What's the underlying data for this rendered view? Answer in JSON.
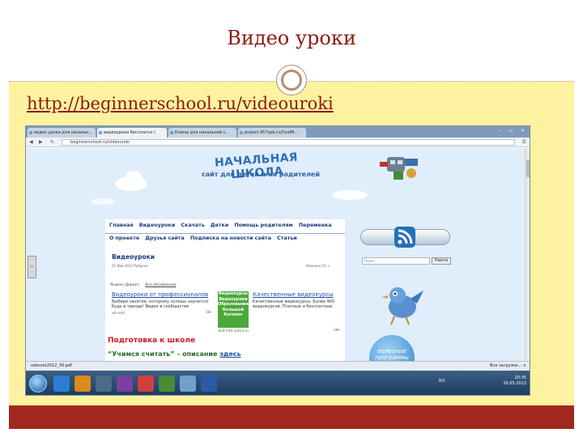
{
  "slide": {
    "title": "Видео уроки",
    "link": "http://beginnerschool.ru/videouroki"
  },
  "browser": {
    "tabs": [
      {
        "label": "видео уроки для начальн..."
      },
      {
        "label": "видеоуроки бесплатно ("
      },
      {
        "label": "Клипы для начальной с..."
      },
      {
        "label": "project.457spb.ru/DvaMi..."
      }
    ],
    "url": "beginnerschool.ru/videouroki"
  },
  "site": {
    "header_title": "НАЧАЛЬНАЯ ШКОЛА",
    "header_subtitle": "сайт для детей и их родителей",
    "menu_row1": [
      "Главная",
      "Видеоуроки",
      "Скачать",
      "Детки",
      "Помощь родителям",
      "Переменка"
    ],
    "menu_row2": [
      "О проекте",
      "Друзья сайта",
      "Подписка на новости сайта",
      "Статьи"
    ],
    "section_title": "Видеоуроки",
    "section_date": "25 Фев 2012 Рубрика",
    "section_meta": "Изменен (0) »",
    "ads_header": [
      "Яндекс.Директ",
      "Все объявления"
    ],
    "ad1": {
      "title": "Видеоуроки от профессионалов",
      "text": "Выбери занятие, которому хочешь научится! Будь в тренде! Видео в сообществе",
      "site": "vk.com",
      "age": "18+"
    },
    "ad_box": [
      "Видеокурсы",
      "Видеоуроки",
      "Образование",
      "Большой",
      "Каталог"
    ],
    "ad_box_site": "dvd-info.sotca.ru",
    "ad2": {
      "title": "Качественные видеокурсы",
      "text": "Качественные видеокурсы. Более 900 видеокурсов. Платные и бесплатные.",
      "age": "18+"
    },
    "prep_title": "Подготовка к школе",
    "prep_sub_quote": "“Учимся считать”",
    "prep_sub_dash": " – описание ",
    "prep_sub_link": "здесь",
    "search_placeholder": "Поиск",
    "search_button": "Найти",
    "programs_label": "полезные программы",
    "side_tab": "»"
  },
  "downloads": {
    "file": "odecset2012_30.pdf",
    "show_all": "Все загрузки...",
    "close": "×"
  },
  "taskbar": {
    "lang": "RU",
    "time": "20:35",
    "date": "26.05.2013"
  },
  "colors": {
    "title_color": "#8b1a10",
    "content_bg": "#fdf2a0",
    "footer": "#a0281e"
  }
}
